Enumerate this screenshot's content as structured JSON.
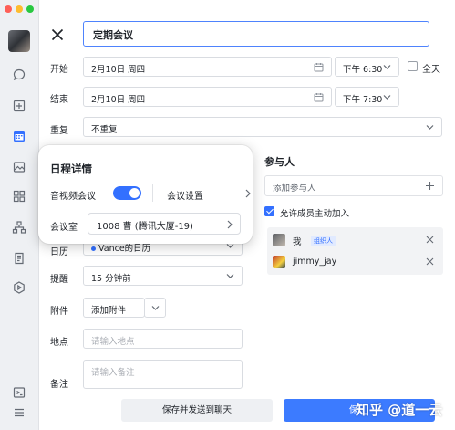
{
  "form": {
    "title_value": "定期会议",
    "start": {
      "label": "开始",
      "date": "2月10日 周四",
      "time": "下午 6:30"
    },
    "end": {
      "label": "结束",
      "date": "2月10日 周四",
      "time": "下午 7:30"
    },
    "all_day_label": "全天",
    "all_day_checked": false,
    "repeat": {
      "label": "重复",
      "value": "不重复"
    },
    "calendar": {
      "label": "日历",
      "value": "Vance的日历",
      "dot_color": "#3370ff"
    },
    "reminder": {
      "label": "提醒",
      "value": "15 分钟前"
    },
    "attachment": {
      "label": "附件",
      "button": "添加附件"
    },
    "location": {
      "label": "地点",
      "placeholder": "请输入地点"
    },
    "notes": {
      "label": "备注",
      "placeholder": "请输入备注"
    }
  },
  "participants": {
    "title": "参与人",
    "add_placeholder": "添加参与人",
    "allow_join_label": "允许成员主动加入",
    "allow_join_checked": true,
    "list": [
      {
        "name": "我",
        "tag": "组织人"
      },
      {
        "name": "jimmy_jay",
        "tag": ""
      }
    ]
  },
  "popup": {
    "title": "日程详情",
    "av_label": "音视频会议",
    "av_enabled": true,
    "settings_label": "会议设置",
    "room_label": "会议室",
    "room_value": "1008 曹 (腾讯大厦-19)"
  },
  "footer": {
    "save_send_label": "保存并发送到聊天",
    "save_label": "保",
    "watermark": "知乎 @道一云"
  },
  "colors": {
    "accent": "#3370ff",
    "primary_button": "#3c7bff"
  },
  "sidebar_icons": [
    "chat-icon",
    "workspace-icon",
    "calendar-icon",
    "image-icon",
    "apps-icon",
    "org-icon",
    "approval-icon",
    "video-icon",
    "collapse-icon",
    "menu-icon"
  ]
}
